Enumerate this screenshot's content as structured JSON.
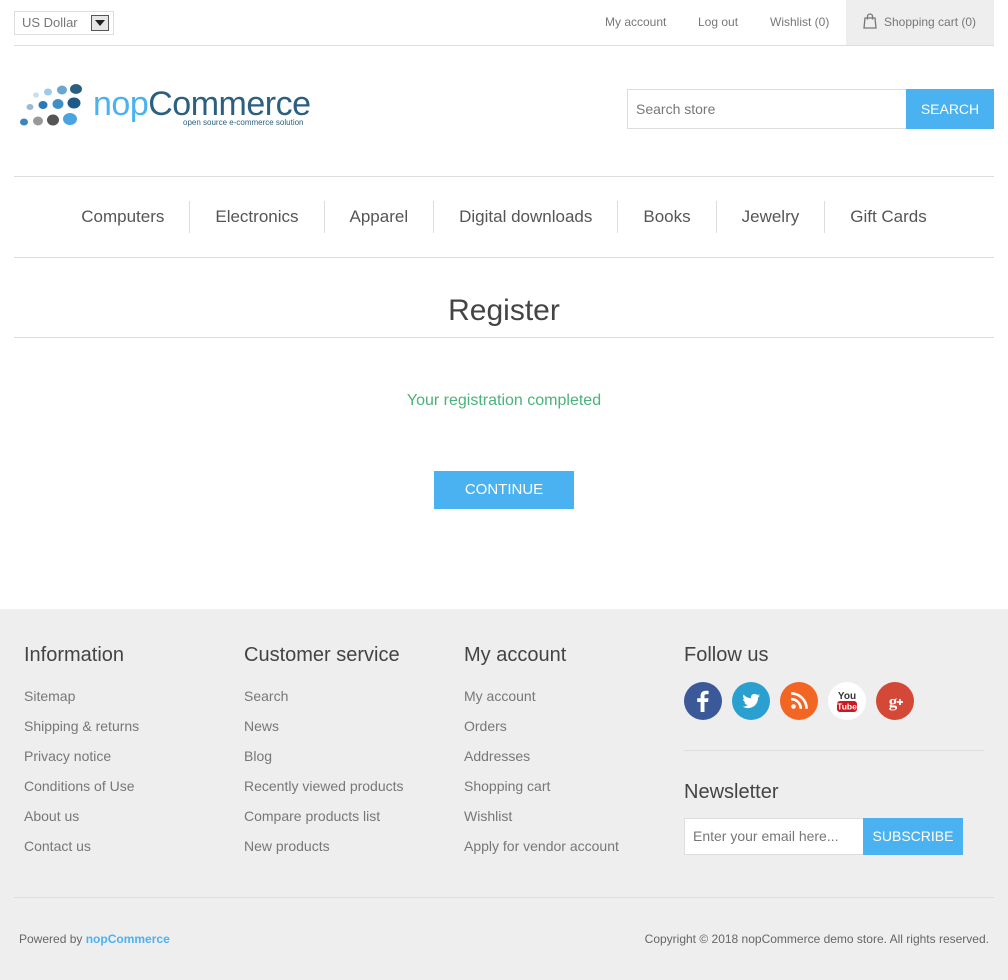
{
  "header": {
    "currency": "US Dollar",
    "links": {
      "my_account": "My account",
      "logout": "Log out",
      "wishlist": "Wishlist (0)",
      "cart": "Shopping cart (0)"
    }
  },
  "logo": {
    "name_part1": "nop",
    "name_part2": "Commerce",
    "tagline": "open source e-commerce solution"
  },
  "search": {
    "placeholder": "Search store",
    "button": "Search"
  },
  "menu": [
    "Computers",
    "Electronics",
    "Apparel",
    "Digital downloads",
    "Books",
    "Jewelry",
    "Gift Cards"
  ],
  "page": {
    "title": "Register",
    "result": "Your registration completed",
    "continue": "Continue"
  },
  "footer": {
    "information": {
      "title": "Information",
      "links": [
        "Sitemap",
        "Shipping & returns",
        "Privacy notice",
        "Conditions of Use",
        "About us",
        "Contact us"
      ]
    },
    "customer_service": {
      "title": "Customer service",
      "links": [
        "Search",
        "News",
        "Blog",
        "Recently viewed products",
        "Compare products list",
        "New products"
      ]
    },
    "my_account": {
      "title": "My account",
      "links": [
        "My account",
        "Orders",
        "Addresses",
        "Shopping cart",
        "Wishlist",
        "Apply for vendor account"
      ]
    },
    "follow": {
      "title": "Follow us",
      "icons": [
        "facebook-icon",
        "twitter-icon",
        "rss-icon",
        "youtube-icon",
        "google-plus-icon"
      ]
    },
    "newsletter": {
      "title": "Newsletter",
      "placeholder": "Enter your email here...",
      "button": "Subscribe"
    },
    "powered_prefix": "Powered by",
    "powered_brand": "nopCommerce",
    "copyright": "Copyright © 2018 nopCommerce demo store. All rights reserved."
  },
  "colors": {
    "accent": "#4ab2f1",
    "success": "#4cb17c",
    "footer_bg": "#eeeeee"
  }
}
